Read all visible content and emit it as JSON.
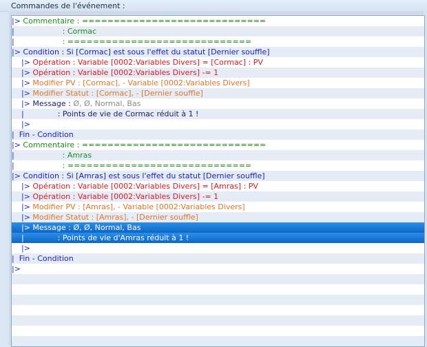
{
  "header": {
    "title": "Commandes de l'événement :"
  },
  "rows": [
    {
      "indent": "|> ",
      "parts": [
        {
          "t": "Commentaire : =============================",
          "c": "c-comment"
        }
      ]
    },
    {
      "indent": "|",
      "parts": [
        {
          "t": "                    : Cormac",
          "c": "c-comment"
        }
      ]
    },
    {
      "indent": "|",
      "parts": [
        {
          "t": "                    : =============================",
          "c": "c-comment"
        }
      ]
    },
    {
      "indent": "|> ",
      "parts": [
        {
          "t": "Condition : Si [Cormac] est sous l'effet du statut [Dernier souffle]",
          "c": "c-cond"
        }
      ]
    },
    {
      "indent": "    |> ",
      "parts": [
        {
          "t": "Opération : Variable [0002:Variables Divers] = [Cormac] : PV",
          "c": "c-op"
        }
      ]
    },
    {
      "indent": "    |> ",
      "parts": [
        {
          "t": "Opération : Variable [0002:Variables Divers] -= 1",
          "c": "c-op"
        }
      ]
    },
    {
      "indent": "    |> ",
      "parts": [
        {
          "t": "Modifier PV : [Cormac], - Variable [0002:Variables Divers]",
          "c": "c-mod"
        }
      ]
    },
    {
      "indent": "    |> ",
      "parts": [
        {
          "t": "Modifier Statut : [Cormac], - [Dernier souffle]",
          "c": "c-mod"
        }
      ]
    },
    {
      "indent": "    |> ",
      "parts": [
        {
          "t": "Message : ",
          "c": "c-dark"
        },
        {
          "t": "Ø, Ø, Normal, Bas",
          "c": "c-msgarg"
        }
      ]
    },
    {
      "indent": "    |",
      "parts": [
        {
          "t": "              : Points de vie de Cormac réduit à 1 !",
          "c": "c-msg"
        }
      ]
    },
    {
      "indent": "    |> ",
      "parts": []
    },
    {
      "indent": "|  ",
      "parts": [
        {
          "t": "Fin - Condition",
          "c": "c-cond"
        }
      ]
    },
    {
      "indent": "|> ",
      "parts": [
        {
          "t": "Commentaire : =============================",
          "c": "c-comment"
        }
      ]
    },
    {
      "indent": "|",
      "parts": [
        {
          "t": "                    : Amras",
          "c": "c-comment"
        }
      ]
    },
    {
      "indent": "|",
      "parts": [
        {
          "t": "                    : =============================",
          "c": "c-comment"
        }
      ]
    },
    {
      "indent": "|> ",
      "parts": [
        {
          "t": "Condition : Si [Amras] est sous l'effet du statut [Dernier souffle]",
          "c": "c-cond"
        }
      ]
    },
    {
      "indent": "    |> ",
      "parts": [
        {
          "t": "Opération : Variable [0002:Variables Divers] = [Amras] : PV",
          "c": "c-op"
        }
      ]
    },
    {
      "indent": "    |> ",
      "parts": [
        {
          "t": "Opération : Variable [0002:Variables Divers] -= 1",
          "c": "c-op"
        }
      ]
    },
    {
      "indent": "    |> ",
      "parts": [
        {
          "t": "Modifier PV : [Amras], - Variable [0002:Variables Divers]",
          "c": "c-mod"
        }
      ]
    },
    {
      "indent": "    |> ",
      "parts": [
        {
          "t": "Modifier Statut : [Amras], - [Dernier souffle]",
          "c": "c-mod"
        }
      ]
    },
    {
      "indent": "    |> ",
      "selected": true,
      "parts": [
        {
          "t": "Message : Ø, Ø, Normal, Bas",
          "c": "c-dark"
        }
      ]
    },
    {
      "indent": "    |",
      "selected": true,
      "parts": [
        {
          "t": "              : Points de vie d'Amras réduit à 1 !",
          "c": "c-dark"
        }
      ]
    },
    {
      "indent": "    |> ",
      "parts": []
    },
    {
      "indent": "|  ",
      "parts": [
        {
          "t": "Fin - Condition",
          "c": "c-cond"
        }
      ]
    },
    {
      "indent": "|> ",
      "parts": []
    }
  ]
}
